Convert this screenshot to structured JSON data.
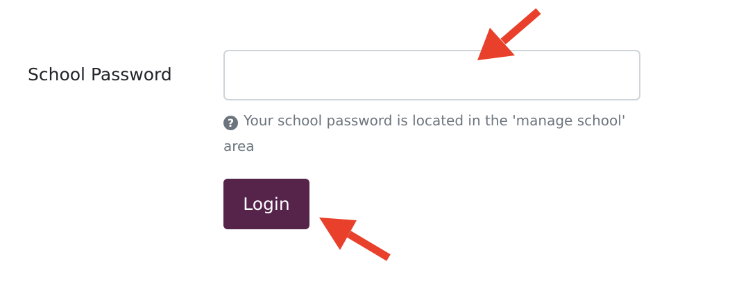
{
  "form": {
    "password_label": "School Password",
    "password_value": "",
    "password_placeholder": "",
    "help_text": "Your school password is located in the 'manage school' area",
    "help_icon": "question-circle-icon",
    "login_label": "Login"
  },
  "colors": {
    "button_bg": "#56234b",
    "arrow": "#e8402a",
    "help_text": "#6c757d",
    "input_border": "#ced4da"
  }
}
